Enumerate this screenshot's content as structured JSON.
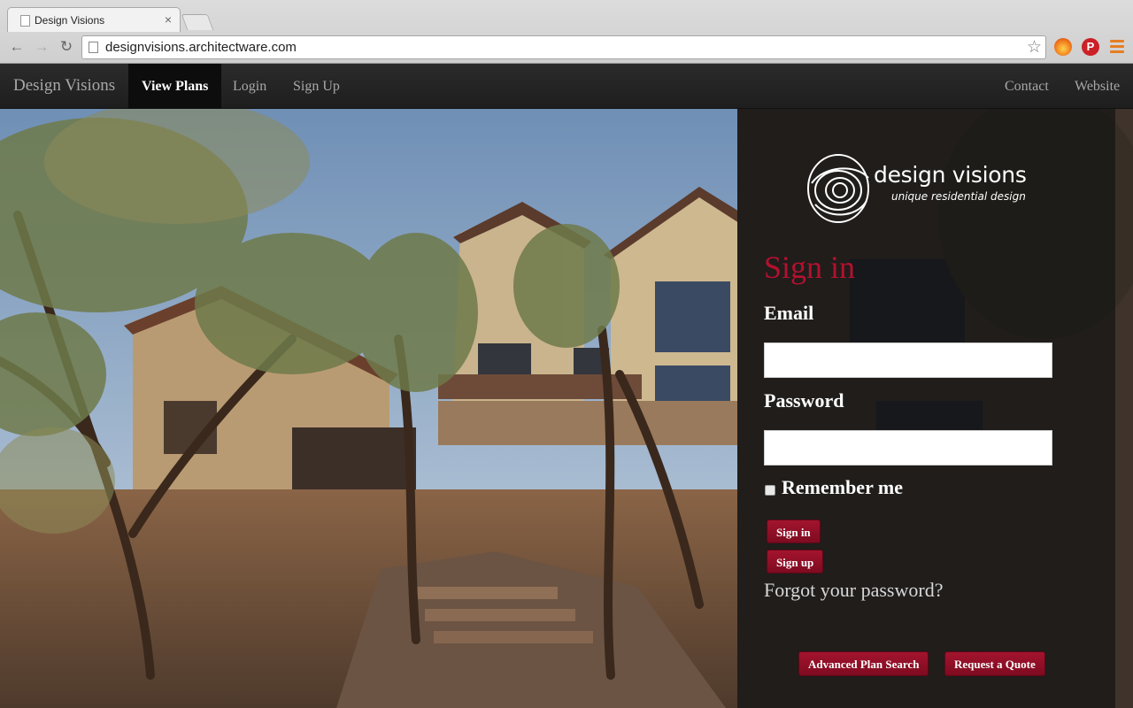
{
  "browser": {
    "tab_title": "Design Visions",
    "tab_close": "×",
    "url": "designvisions.architectware.com",
    "icons": {
      "back": "back-arrow-icon",
      "forward": "forward-arrow-icon",
      "reload": "reload-icon",
      "star": "bookmark-star-icon",
      "extension1": "firefox-like-extension-icon",
      "extension2": "pinterest-icon",
      "menu": "hamburger-menu-icon"
    },
    "glyphs": {
      "back": "←",
      "forward": "→",
      "reload": "↻",
      "star": "☆",
      "pin": "P"
    }
  },
  "nav": {
    "brand": "Design Visions",
    "items": [
      {
        "label": "View Plans",
        "active": true
      },
      {
        "label": "Login",
        "active": false
      },
      {
        "label": "Sign Up",
        "active": false
      }
    ],
    "right_items": [
      {
        "label": "Contact"
      },
      {
        "label": "Website"
      }
    ]
  },
  "logo": {
    "name": "design visions",
    "tagline": "unique residential design"
  },
  "signin": {
    "title": "Sign in",
    "email_label": "Email",
    "email_value": "",
    "password_label": "Password",
    "password_value": "",
    "remember_label": "Remember me",
    "remember_checked": false,
    "signin_button": "Sign in",
    "signup_button": "Sign up",
    "forgot_link": "Forgot your password?"
  },
  "footer_actions": {
    "advanced_search": "Advanced Plan Search",
    "request_quote": "Request a Quote"
  },
  "colors": {
    "accent": "#b3112e",
    "button": "#9a1229",
    "nav_bg": "#232323"
  }
}
